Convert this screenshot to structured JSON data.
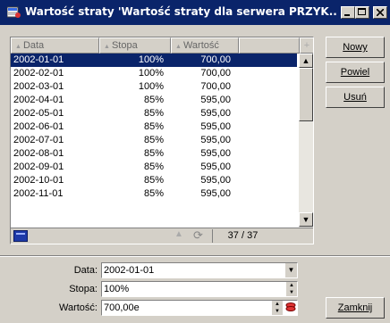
{
  "window": {
    "title": "Wartość straty 'Wartość straty dla serwera PRZYK...",
    "accent": "#0a246a"
  },
  "grid": {
    "columns": [
      "Data",
      "Stopa",
      "Wartość"
    ],
    "rows": [
      {
        "data": "2002-01-01",
        "stopa": "100%",
        "wartosc": "700,00",
        "selected": true
      },
      {
        "data": "2002-02-01",
        "stopa": "100%",
        "wartosc": "700,00"
      },
      {
        "data": "2002-03-01",
        "stopa": "100%",
        "wartosc": "700,00"
      },
      {
        "data": "2002-04-01",
        "stopa": "85%",
        "wartosc": "595,00"
      },
      {
        "data": "2002-05-01",
        "stopa": "85%",
        "wartosc": "595,00"
      },
      {
        "data": "2002-06-01",
        "stopa": "85%",
        "wartosc": "595,00"
      },
      {
        "data": "2002-07-01",
        "stopa": "85%",
        "wartosc": "595,00"
      },
      {
        "data": "2002-08-01",
        "stopa": "85%",
        "wartosc": "595,00"
      },
      {
        "data": "2002-09-01",
        "stopa": "85%",
        "wartosc": "595,00"
      },
      {
        "data": "2002-10-01",
        "stopa": "85%",
        "wartosc": "595,00"
      },
      {
        "data": "2002-11-01",
        "stopa": "85%",
        "wartosc": "595,00"
      }
    ],
    "record_count": "37 / 37"
  },
  "buttons": {
    "new": "Nowy",
    "duplicate": "Powiel",
    "delete": "Usuń",
    "close": "Zamknij"
  },
  "form": {
    "data_label": "Data:",
    "data_value": "2002-01-01",
    "stopa_label": "Stopa:",
    "stopa_value": "100%",
    "wartosc_label": "Wartość:",
    "wartosc_value": "700,00e"
  }
}
